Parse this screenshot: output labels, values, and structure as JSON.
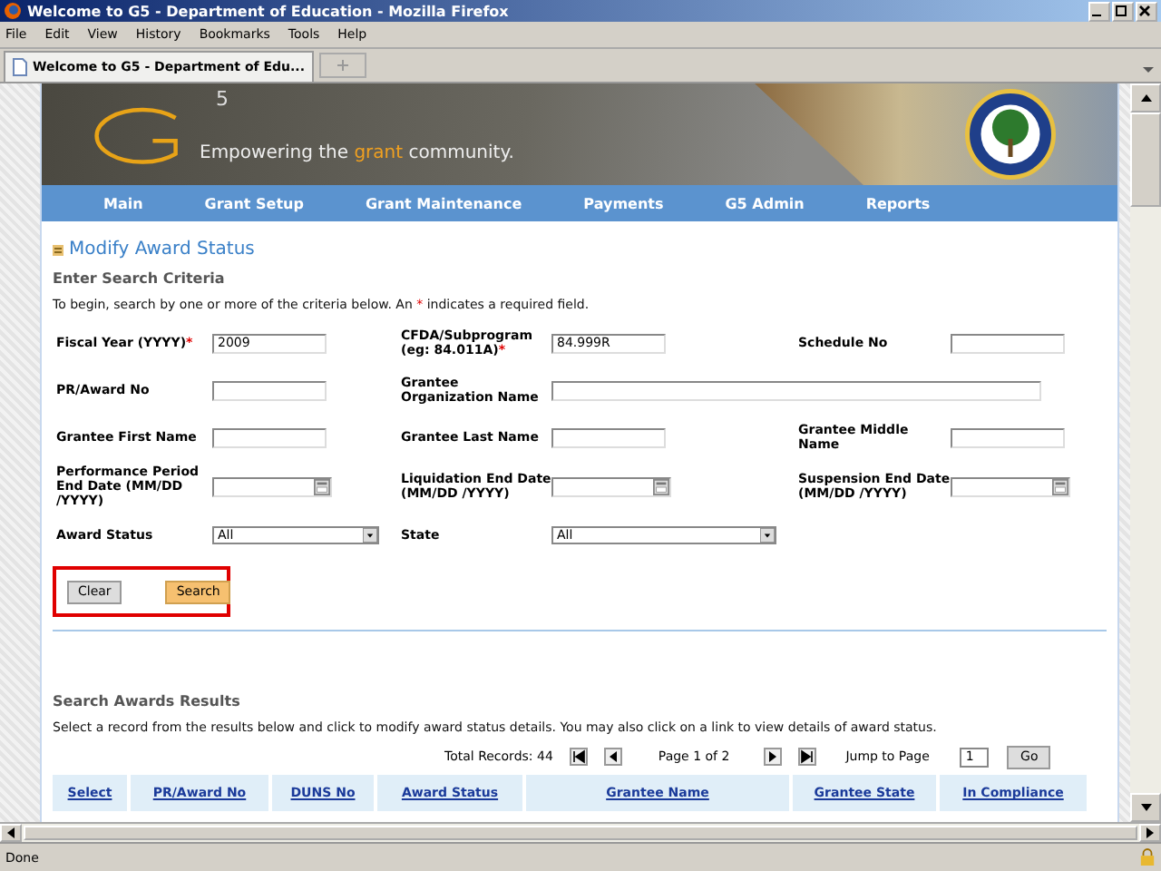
{
  "window": {
    "title": "Welcome to G5 - Department of Education - Mozilla Firefox"
  },
  "menu": [
    "File",
    "Edit",
    "View",
    "History",
    "Bookmarks",
    "Tools",
    "Help"
  ],
  "tabs": [
    {
      "label": "Welcome to G5 - Department of Edu...",
      "selected": true
    }
  ],
  "banner": {
    "logo_number": "5",
    "tagline_before": "Empowering the",
    "tagline_highlight": "grant",
    "tagline_after": "community."
  },
  "nav": [
    "Main",
    "Grant Setup",
    "Grant Maintenance",
    "Payments",
    "G5 Admin",
    "Reports"
  ],
  "page_title": "Modify Award Status",
  "criteria": {
    "heading": "Enter Search Criteria",
    "note_before": "To begin, search by one or more of the criteria below. An",
    "note_mark": "*",
    "note_after": "indicates a required field.",
    "rows": [
      [
        {
          "label": "Fiscal Year (YYYY)",
          "required": true,
          "kind": "text",
          "value": "2009"
        },
        {
          "label": "CFDA/Subprogram (eg: 84.011A)",
          "required": true,
          "kind": "text",
          "value": "84.999R"
        },
        {
          "label": "Schedule No",
          "required": false,
          "kind": "text"
        }
      ],
      [
        {
          "label": "PR/Award No",
          "required": false,
          "kind": "text"
        },
        {
          "label": "Grantee Organization Name",
          "required": false,
          "kind": "wide"
        }
      ],
      [
        {
          "label": "Grantee First Name",
          "required": false,
          "kind": "text"
        },
        {
          "label": "Grantee Last Name",
          "required": false,
          "kind": "text"
        },
        {
          "label": "Grantee Middle Name",
          "required": false,
          "kind": "text"
        }
      ],
      [
        {
          "label": "Performance Period End Date (MM/DD /YYYY)",
          "required": false,
          "kind": "date"
        },
        {
          "label": "Liquidation End Date (MM/DD /YYYY)",
          "required": false,
          "kind": "date"
        },
        {
          "label": "Suspension End Date (MM/DD /YYYY)",
          "required": false,
          "kind": "date"
        }
      ],
      [
        {
          "label": "Award Status",
          "required": false,
          "kind": "select",
          "value": "All"
        },
        {
          "label": "State",
          "required": false,
          "kind": "select",
          "value": "All"
        }
      ]
    ],
    "buttons": [
      {
        "label": "Clear",
        "primary": false
      },
      {
        "label": "Search",
        "primary": true
      }
    ]
  },
  "results": {
    "heading": "Search Awards Results",
    "note": "Select a record from the results below and click to modify award status details. You may also click on a link to view details of award status.",
    "total": "Total Records: 44",
    "page": "Page 1 of 2",
    "jump_label": "Jump to Page",
    "jump_value": "1",
    "go": "Go",
    "columns": [
      "Select",
      "PR/Award No",
      "DUNS No",
      "Award Status",
      "Grantee Name",
      "Grantee State",
      "In Compliance"
    ]
  },
  "status_bar": "Done"
}
